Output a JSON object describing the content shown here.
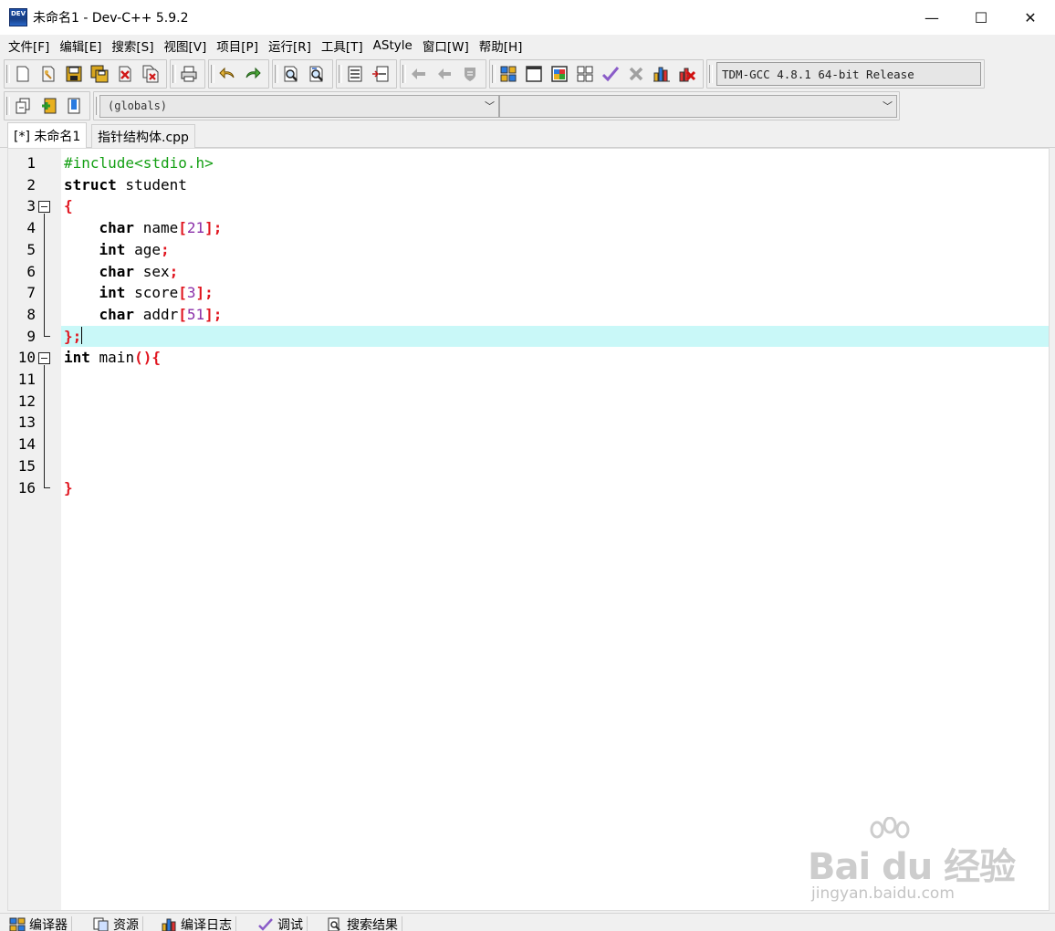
{
  "window": {
    "title": "未命名1 - Dev-C++ 5.9.2",
    "app_icon_text": "DEV",
    "minimize": "—",
    "maximize": "☐",
    "close": "✕"
  },
  "menu": [
    "文件[F]",
    "编辑[E]",
    "搜索[S]",
    "视图[V]",
    "项目[P]",
    "运行[R]",
    "工具[T]",
    "AStyle",
    "窗口[W]",
    "帮助[H]"
  ],
  "toolbar": {
    "compiler": "TDM-GCC 4.8.1 64-bit Release"
  },
  "toolbar2": {
    "scope_select": "(globals)",
    "member_select": ""
  },
  "tabs": [
    {
      "label": "[*] 未命名1",
      "active": true
    },
    {
      "label": "指针结构体.cpp",
      "active": false
    }
  ],
  "editor": {
    "line_numbers": [
      "1",
      "2",
      "3",
      "4",
      "5",
      "6",
      "7",
      "8",
      "9",
      "10",
      "11",
      "12",
      "13",
      "14",
      "15",
      "16"
    ],
    "current_line": 9
  },
  "bottom_tabs": [
    "编译器",
    "资源",
    "编译日志",
    "调试",
    "搜索结果"
  ],
  "watermark": {
    "logo_text": "Bai  du 经验",
    "url": "jingyan.baidu.com"
  }
}
